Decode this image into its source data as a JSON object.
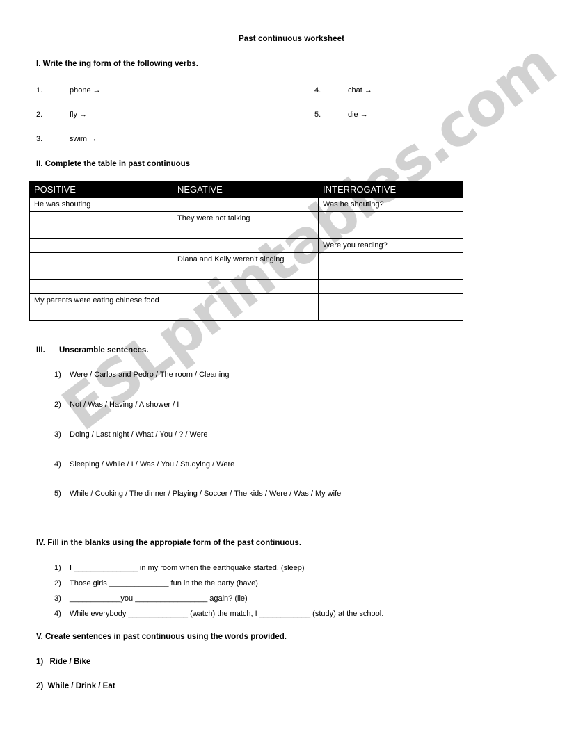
{
  "document": {
    "title": "Past continuous worksheet",
    "watermark": "ESLprintables.com"
  },
  "section_1": {
    "heading": "I. Write the ing form of the following verbs.",
    "items_left": [
      {
        "num": "1.",
        "word": "phone →"
      },
      {
        "num": "2.",
        "word": "fly →"
      },
      {
        "num": "3.",
        "word": "swim →"
      }
    ],
    "items_right": [
      {
        "num": "4.",
        "word": "chat →"
      },
      {
        "num": "5.",
        "word": "die →"
      }
    ]
  },
  "section_2": {
    "heading": "II. Complete the table in past continuous",
    "table": {
      "headers": [
        "POSITIVE",
        "NEGATIVE",
        "INTERROGATIVE"
      ],
      "rows": [
        [
          "He was shouting",
          "",
          "Was he shouting?"
        ],
        [
          "",
          "They were not talking",
          ""
        ],
        [
          "",
          "",
          "Were you reading?"
        ],
        [
          "",
          "Diana and Kelly weren’t singing",
          ""
        ],
        [
          "",
          "",
          ""
        ],
        [
          "My parents were eating chinese food",
          "",
          ""
        ]
      ]
    }
  },
  "section_3": {
    "numeral": "III.",
    "heading": "Unscramble sentences.",
    "items": [
      {
        "num": "1)",
        "text": "Were / Carlos and Pedro / The room  / Cleaning"
      },
      {
        "num": "2)",
        "text": "Not / Was / Having / A shower  / I"
      },
      {
        "num": "3)",
        "text": "Doing / Last night / What / You / ? / Were"
      },
      {
        "num": "4)",
        "text": "Sleeping /  While / I / Was / You / Studying / Were"
      },
      {
        "num": "5)",
        "text": "While / Cooking / The dinner / Playing / Soccer / The kids / Were / Was / My wife"
      }
    ]
  },
  "section_4": {
    "heading": "IV. Fill in the blanks using the appropiate form of the past continuous.",
    "items": [
      {
        "num": "1)",
        "text": "I _______________ in my room when the earthquake started. (sleep)"
      },
      {
        "num": "2)",
        "text": "Those girls ______________ fun in the the party (have)"
      },
      {
        "num": "3)",
        "text": "____________you _________________ again? (lie)"
      },
      {
        "num": "4)",
        "text": "While everybody ______________  (watch) the match, I ____________  (study) at the school."
      }
    ]
  },
  "section_5": {
    "heading": "V. Create sentences in past continuous using the words provided.",
    "items": [
      {
        "num": "1)",
        "text": "Ride / Bike"
      },
      {
        "num": "2)",
        "text": "While / Drink / Eat"
      }
    ]
  }
}
